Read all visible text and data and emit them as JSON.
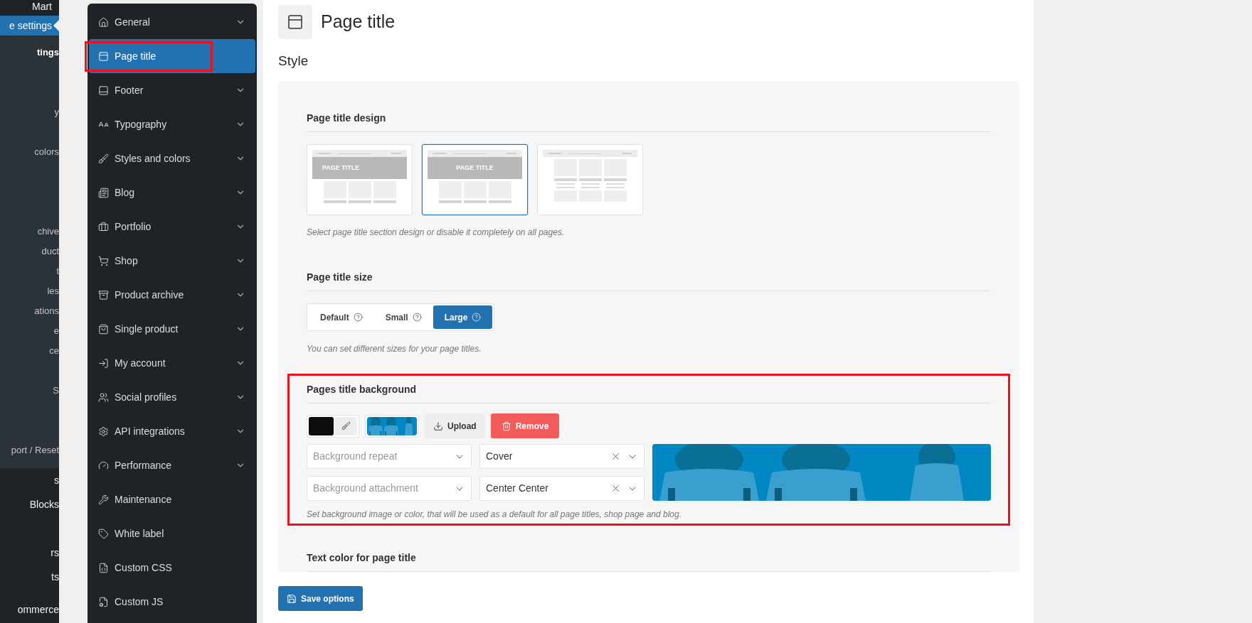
{
  "wp_menu": {
    "top": [
      {
        "label": "Mart",
        "selected": false
      },
      {
        "label": "e settings",
        "selected": true
      }
    ],
    "submenu": [
      {
        "label": "tings",
        "selected": true
      },
      {
        "label": "y",
        "selected": false
      },
      {
        "label": "colors",
        "selected": false
      },
      {
        "label": "chive",
        "selected": false
      },
      {
        "label": "duct",
        "selected": false
      },
      {
        "label": "t",
        "selected": false
      },
      {
        "label": "les",
        "selected": false
      },
      {
        "label": "ations",
        "selected": false
      },
      {
        "label": "e",
        "selected": false
      },
      {
        "label": "ce",
        "selected": false
      },
      {
        "label": "S",
        "selected": false
      },
      {
        "label": "port / Reset",
        "selected": false
      }
    ],
    "bottom": [
      {
        "label": "s",
        "selected": false
      },
      {
        "label": "Blocks",
        "selected": false
      },
      {
        "label": "rs",
        "selected": false
      },
      {
        "label": "ts",
        "selected": false
      },
      {
        "label": "ommerce",
        "selected": false
      }
    ]
  },
  "settings_nav": [
    {
      "label": "General",
      "selected": false,
      "expandable": true
    },
    {
      "label": "Page title",
      "selected": true,
      "expandable": false
    },
    {
      "label": "Footer",
      "selected": false,
      "expandable": true
    },
    {
      "label": "Typography",
      "selected": false,
      "expandable": true
    },
    {
      "label": "Styles and colors",
      "selected": false,
      "expandable": true
    },
    {
      "label": "Blog",
      "selected": false,
      "expandable": true
    },
    {
      "label": "Portfolio",
      "selected": false,
      "expandable": true
    },
    {
      "label": "Shop",
      "selected": false,
      "expandable": true
    },
    {
      "label": "Product archive",
      "selected": false,
      "expandable": true
    },
    {
      "label": "Single product",
      "selected": false,
      "expandable": true
    },
    {
      "label": "My account",
      "selected": false,
      "expandable": true
    },
    {
      "label": "Social profiles",
      "selected": false,
      "expandable": true
    },
    {
      "label": "API integrations",
      "selected": false,
      "expandable": true
    },
    {
      "label": "Performance",
      "selected": false,
      "expandable": true
    },
    {
      "label": "Maintenance",
      "selected": false,
      "expandable": false
    },
    {
      "label": "White label",
      "selected": false,
      "expandable": false
    },
    {
      "label": "Custom CSS",
      "selected": false,
      "expandable": false
    },
    {
      "label": "Custom JS",
      "selected": false,
      "expandable": false
    }
  ],
  "page": {
    "title": "Page title",
    "section": "Style"
  },
  "design": {
    "label": "Page title design",
    "options": [
      {
        "kind": "left",
        "title_text": "PAGE TITLE",
        "selected": false
      },
      {
        "kind": "centered",
        "title_text": "PAGE TITLE",
        "selected": true
      },
      {
        "kind": "grid",
        "selected": false
      }
    ],
    "caption": "Select page title section design or disable it completely on all pages."
  },
  "size": {
    "label": "Page title size",
    "options": [
      {
        "label": "Default",
        "selected": false
      },
      {
        "label": "Small",
        "selected": false
      },
      {
        "label": "Large",
        "selected": true
      }
    ],
    "caption": "You can set different sizes for your page titles."
  },
  "background": {
    "label": "Pages title background",
    "color": "#0d0d0d",
    "upload": "Upload",
    "remove": "Remove",
    "selects": [
      {
        "placeholder": "Background repeat"
      },
      {
        "value": "Cover"
      },
      {
        "placeholder": "Background attachment"
      },
      {
        "value": "Center Center"
      }
    ],
    "caption": "Set background image or color, that will be used as a default for all page titles, shop page and blog."
  },
  "text_color": {
    "label": "Text color for page title"
  },
  "save": "Save options"
}
